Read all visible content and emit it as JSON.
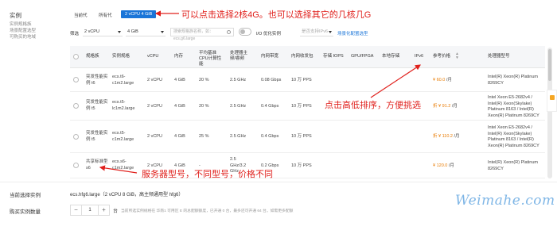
{
  "sidebar": {
    "title": "实例",
    "items": [
      "实例规格族",
      "场景配置选型",
      "可购买的地域"
    ]
  },
  "tabs": [
    "当前代",
    "所有代",
    "2 vCPU 4 GiB"
  ],
  "filter": {
    "label": "筛选",
    "vcpu": "2 vCPU",
    "memory": "4 GiB",
    "search_placeholder": "搜索规格族名称，如：ecs.g6.large",
    "io_label": "I/O 优化实例",
    "ipv6_placeholder": "是否支持IPv6",
    "scenario_link": "场景化配置选型"
  },
  "table": {
    "headers": [
      "规格族",
      "实例规格",
      "vCPU",
      "内存",
      "平均基准CPU计算性能",
      "处理器主频/睿频",
      "内网带宽",
      "内网收发包",
      "存储 IOPS",
      "GPU/FPGA",
      "本地存储",
      "IPv6",
      "参考价格",
      "处理器型号"
    ],
    "rows": [
      {
        "family": "突发性能实例 t6",
        "spec": "ecs.t6-c1m2.large",
        "vcpu": "2 vCPU",
        "memory": "4 GiB",
        "baseline": "20 %",
        "freq": "2.5 GHz",
        "bandwidth": "0.08 Gbps",
        "pps": "10 万 PPS",
        "iops": "",
        "gpu": "",
        "local": "",
        "ipv6": "",
        "price": "¥ 60.0",
        "unit": "/月",
        "cpu_model": "Intel(R) Xeon(R) Platinum 8269CY"
      },
      {
        "family": "突发性能实例 t5",
        "spec": "ecs.t5-lc1m2.large",
        "vcpu": "2 vCPU",
        "memory": "4 GiB",
        "baseline": "20 %",
        "freq": "2.5 GHz",
        "bandwidth": "0.4 Gbps",
        "pps": "10 万 PPS",
        "iops": "",
        "gpu": "",
        "local": "",
        "ipv6": "",
        "price": "¥ 91.2",
        "discount": "折",
        "unit": "/月",
        "cpu_model": "Intel Xeon E5-2682v4 / Intel(R) Xeon(Skylake) Platinum 8163 / Intel(R) Xeon(R) Platinum 8269CY"
      },
      {
        "family": "突发性能实例 t5",
        "spec": "ecs.t5-c1m2.large",
        "vcpu": "2 vCPU",
        "memory": "4 GiB",
        "baseline": "25 %",
        "freq": "2.5 GHz",
        "bandwidth": "0.4 Gbps",
        "pps": "10 万 PPS",
        "iops": "",
        "gpu": "",
        "local": "",
        "ipv6": "",
        "price": "¥ 110.2",
        "discount": "折",
        "unit": "/月",
        "cpu_model": "Intel Xeon E5-2682v4 / Intel(R) Xeon(Skylake) Platinum 8163 / Intel(R) Xeon(R) Platinum 8269CY"
      },
      {
        "family": "共享标准型 s6",
        "spec": "ecs.s6-c1m2.large",
        "vcpu": "2 vCPU",
        "memory": "4 GiB",
        "baseline": "-",
        "freq": "2.5 GHz/3.2 GHz",
        "bandwidth": "0.2 Gbps",
        "pps": "10 万 PPS",
        "iops": "",
        "gpu": "",
        "local": "",
        "ipv6": "",
        "price": "¥ 120.0",
        "unit": "/月",
        "cpu_model": "Intel(R) Xeon(R) Platinum 8269CY"
      }
    ]
  },
  "annotations": {
    "top": "可以点击选择2核4G。也可以选择其它的几核几G",
    "middle": "点击高低排序，方便挑选",
    "bottom": "服务器型号，不同型号，价格不同"
  },
  "footer": {
    "selected_label": "当前选择实例",
    "selected_value": "ecs.hfg6.large（2 vCPU 8 GiB，高主频通用型 hfg6）",
    "quantity_label": "购买实例数量",
    "quantity": "1",
    "unit": "台",
    "note": "当前所选实例规格在 华南1 可用区 E 的总配额额度，已开通 0 台，最多还可开通 64 台。如需更多配额"
  },
  "watermark": "Weimahe.com",
  "colors": {
    "accent": "#1a75d8",
    "annotation": "#e0201c",
    "price": "#e87a00"
  }
}
